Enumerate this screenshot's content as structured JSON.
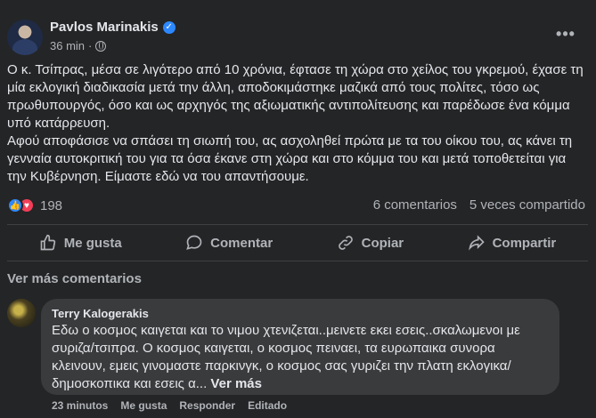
{
  "post": {
    "author": "Pavlos Marinakis",
    "time": "36 min",
    "visibility_icon": "globe-icon",
    "more_icon": "•••",
    "paragraphs": [
      "Ο κ. Τσίπρας, μέσα σε λιγότερο από 10 χρόνια, έφτασε τη χώρα στο χείλος του γκρεμού, έχασε τη μία εκλογική διαδικασία μετά την άλλη, αποδοκιμάστηκε μαζικά από τους πολίτες, τόσο ως πρωθυπουργός, όσο και ως αρχηγός της αξιωματικής αντιπολίτευσης και παρέδωσε ένα κόμμα υπό κατάρρευση.",
      "Αφού αποφάσισε να σπάσει τη σιωπή του, ας ασχοληθεί πρώτα με τα του οίκου του, ας κάνει τη γενναία αυτοκριτική του για τα όσα έκανε στη χώρα και στο κόμμα του και μετά τοποθετείται για την Κυβέρνηση. Είμαστε εδώ να του απαντήσουμε."
    ],
    "reactions_count": "198",
    "comments_count": "6 comentarios",
    "shares_count": "5 veces compartido"
  },
  "actions": {
    "like": "Me gusta",
    "comment": "Comentar",
    "copy": "Copiar",
    "share": "Compartir"
  },
  "more_comments": "Ver más comentarios",
  "comment": {
    "author": "Terry Kalogerakis",
    "text": "Εδω ο κοσμος καιγεται και το νιμου χτενιζεται..μεινετε εκει εσεις..σκαλωμενοι με συριζα/τσιπρα. Ο κοσμος καιγεται, ο κοσμος πειναει, τα ευρωπαικα συνορα κλεινουν, εμεις γινομαστε παρκινγκ, ο κοσμος σας γυριζει την πλατη εκλογικα/δημοσκοπικα και εσεις α...",
    "see_more": "Ver más",
    "time": "23 minutos",
    "like": "Me gusta",
    "reply": "Responder",
    "edited": "Editado"
  },
  "colors": {
    "background": "#242526",
    "text": "#e4e6eb",
    "secondary_text": "#b0b3b8",
    "bubble": "#3a3b3c",
    "accent": "#2d88ff"
  }
}
